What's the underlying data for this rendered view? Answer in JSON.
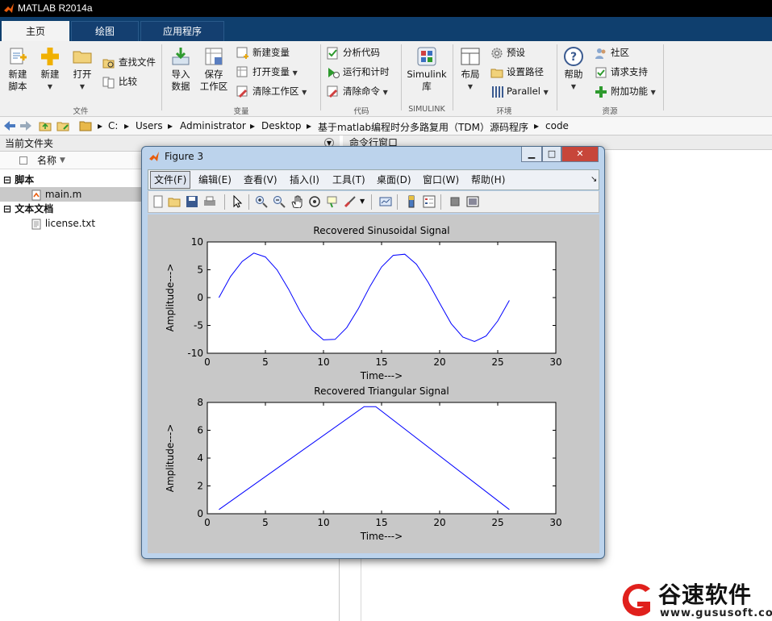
{
  "app": {
    "title": "MATLAB R2014a"
  },
  "tabs": [
    {
      "label": "主页",
      "active": true
    },
    {
      "label": "绘图",
      "active": false
    },
    {
      "label": "应用程序",
      "active": false
    }
  ],
  "ribbon": {
    "file": {
      "new_script": "新建\n脚本",
      "new": "新建",
      "open": "打开",
      "find_files": "查找文件",
      "compare": "比较",
      "section": "文件"
    },
    "variable": {
      "import_data": "导入\n数据",
      "save_workspace": "保存\n工作区",
      "new_variable": "新建变量",
      "open_variable": "打开变量",
      "clear_workspace": "清除工作区",
      "section": "变量"
    },
    "code": {
      "analyze_code": "分析代码",
      "run_and_time": "运行和计时",
      "clear_commands": "清除命令",
      "section": "代码"
    },
    "simulink": {
      "library": "Simulink\n库",
      "section": "SIMULINK"
    },
    "environment": {
      "layout": "布局",
      "preferences": "预设",
      "set_path": "设置路径",
      "parallel": "Parallel",
      "section": "环境"
    },
    "resources": {
      "help": "帮助",
      "community": "社区",
      "request_support": "请求支持",
      "add_ons": "附加功能",
      "section": "资源"
    }
  },
  "address": {
    "path": [
      "C:",
      "Users",
      "Administrator",
      "Desktop",
      "基于matlab编程时分多路复用（TDM）源码程序",
      "code"
    ]
  },
  "left_panel": {
    "title": "当前文件夹",
    "column_name": "名称",
    "groups": [
      {
        "label": "脚本",
        "files": [
          "main.m"
        ]
      },
      {
        "label": "文本文档",
        "files": [
          "license.txt"
        ]
      }
    ]
  },
  "right_panel": {
    "title": "命令行窗口"
  },
  "figure": {
    "title": "Figure 3",
    "menu": [
      "文件(F)",
      "编辑(E)",
      "查看(V)",
      "插入(I)",
      "工具(T)",
      "桌面(D)",
      "窗口(W)",
      "帮助(H)"
    ]
  },
  "chart_data": [
    {
      "type": "line",
      "title": "Recovered Sinusoidal Signal",
      "xlabel": "Time--->",
      "ylabel": "Amplitude--->",
      "xlim": [
        0,
        30
      ],
      "ylim": [
        -10,
        10
      ],
      "xticks": [
        0,
        5,
        10,
        15,
        20,
        25,
        30
      ],
      "yticks": [
        -10,
        -5,
        0,
        5,
        10
      ],
      "color": "#0000ff",
      "x": [
        1,
        2,
        3,
        4,
        5,
        6,
        7,
        8,
        9,
        10,
        11,
        12,
        13,
        14,
        15,
        16,
        17,
        18,
        19,
        20,
        21,
        22,
        23,
        24,
        25,
        26
      ],
      "y": [
        0,
        3.8,
        6.5,
        8.0,
        7.3,
        5.0,
        1.5,
        -2.5,
        -5.8,
        -7.6,
        -7.5,
        -5.4,
        -2.0,
        2.0,
        5.5,
        7.6,
        7.8,
        6.0,
        2.8,
        -1.0,
        -4.7,
        -7.1,
        -7.9,
        -6.9,
        -4.2,
        -0.5
      ]
    },
    {
      "type": "line",
      "title": "Recovered Triangular Signal",
      "xlabel": "Time--->",
      "ylabel": "Amplitude--->",
      "xlim": [
        0,
        30
      ],
      "ylim": [
        0,
        8
      ],
      "xticks": [
        0,
        5,
        10,
        15,
        20,
        25,
        30
      ],
      "yticks": [
        0,
        2,
        4,
        6,
        8
      ],
      "color": "#0000ff",
      "x": [
        1,
        13.5,
        14.5,
        26
      ],
      "y": [
        0.3,
        7.7,
        7.7,
        0.3
      ]
    }
  ],
  "watermark": {
    "brand": "谷速软件",
    "url": "www.gususoft.com",
    "color": "#e0201c"
  }
}
